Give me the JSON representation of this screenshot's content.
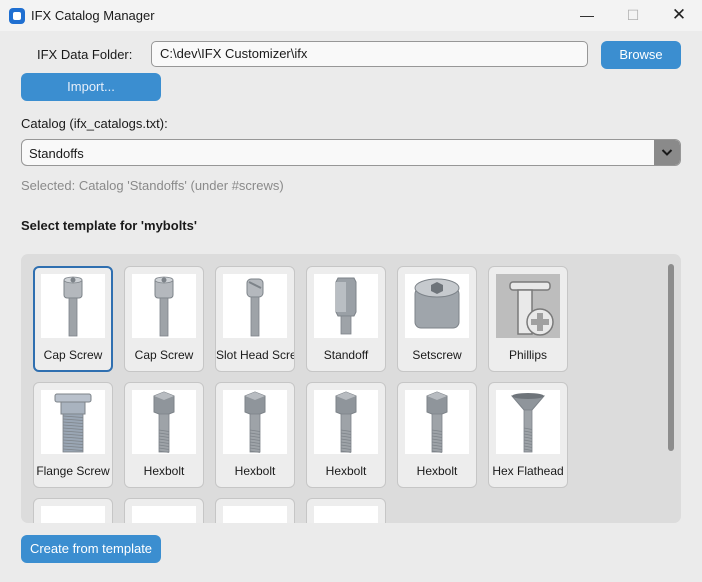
{
  "window": {
    "title": "IFX Catalog Manager",
    "controls": {
      "minimize": "—",
      "maximize": "☐",
      "close": "✕"
    }
  },
  "folder": {
    "label": "IFX Data Folder:",
    "value": "C:\\dev\\IFX Customizer\\ifx",
    "browse_label": "Browse"
  },
  "import_label": "Import...",
  "catalog": {
    "label": "Catalog (ifx_catalogs.txt):",
    "selected": "Standoffs"
  },
  "selected_text": "Selected: Catalog 'Standoffs' (under #screws)",
  "template_section": {
    "title": "Select template for 'mybolts'",
    "items": [
      {
        "label": "Cap Screw",
        "icon": "cap-screw",
        "selected": true
      },
      {
        "label": "Cap Screw",
        "icon": "cap-screw",
        "selected": false
      },
      {
        "label": "Slot Head Screw",
        "icon": "slot-head-screw",
        "selected": false
      },
      {
        "label": "Standoff",
        "icon": "standoff",
        "selected": false
      },
      {
        "label": "Setscrew",
        "icon": "setscrew",
        "selected": false
      },
      {
        "label": "Phillips",
        "icon": "phillips",
        "selected": false
      },
      {
        "label": "Flange Screw",
        "icon": "flange-screw",
        "selected": false
      },
      {
        "label": "Hexbolt",
        "icon": "hexbolt",
        "selected": false
      },
      {
        "label": "Hexbolt",
        "icon": "hexbolt",
        "selected": false
      },
      {
        "label": "Hexbolt",
        "icon": "hexbolt",
        "selected": false
      },
      {
        "label": "Hexbolt",
        "icon": "hexbolt",
        "selected": false
      },
      {
        "label": "Hex Flathead",
        "icon": "hex-flathead",
        "selected": false
      },
      {
        "label": "",
        "icon": "partial-screw",
        "selected": false
      },
      {
        "label": "",
        "icon": "partial-screw",
        "selected": false
      },
      {
        "label": "",
        "icon": "partial-screw",
        "selected": false
      },
      {
        "label": "",
        "icon": "partial-screw",
        "selected": false
      }
    ]
  },
  "colors": {
    "accent": "#3b8ed0",
    "selection_border": "#2f6fb0",
    "muted_text": "#8a8a8a"
  },
  "create_label": "Create from template"
}
